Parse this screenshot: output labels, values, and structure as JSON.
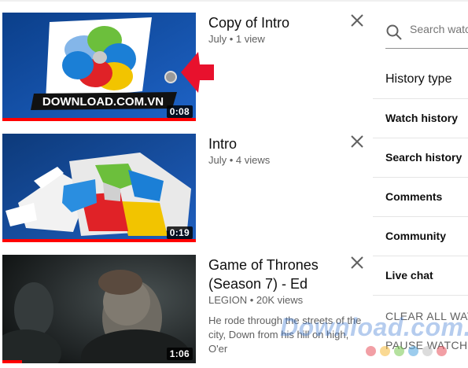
{
  "videos": [
    {
      "title": "Copy of Intro",
      "meta": "July • 1 view",
      "duration": "0:08",
      "progress": 1.0,
      "thumb_watermark": "DOWNLOAD.COM.VN",
      "remove_icon": "close-icon"
    },
    {
      "title": "Intro",
      "meta": "July • 4 views",
      "duration": "0:19",
      "progress": 1.0,
      "remove_icon": "close-icon"
    },
    {
      "title": "Game of Thrones (Season 7) - Ed",
      "meta": "LEGION • 20K views",
      "duration": "1:06",
      "progress": 0.1,
      "description": "He rode through the streets of the city, Down from his hill on high, O'er",
      "remove_icon": "close-icon"
    }
  ],
  "sidebar": {
    "search_placeholder": "Search watch history",
    "search_icon": "search-icon",
    "history_type_label": "History type",
    "options": [
      "Watch history",
      "Search history",
      "Comments",
      "Community",
      "Live chat"
    ],
    "actions": [
      "CLEAR ALL WATCH HISTORY",
      "PAUSE WATCH HISTORY"
    ]
  },
  "watermark": {
    "text": "Download.com.vn",
    "dot_colors": [
      "#e8505b",
      "#f6b93b",
      "#78c850",
      "#4aa3df",
      "#c0c0c0",
      "#e8505b"
    ]
  },
  "colors": {
    "progress": "#ff0000",
    "arrow": "#e8112d"
  }
}
